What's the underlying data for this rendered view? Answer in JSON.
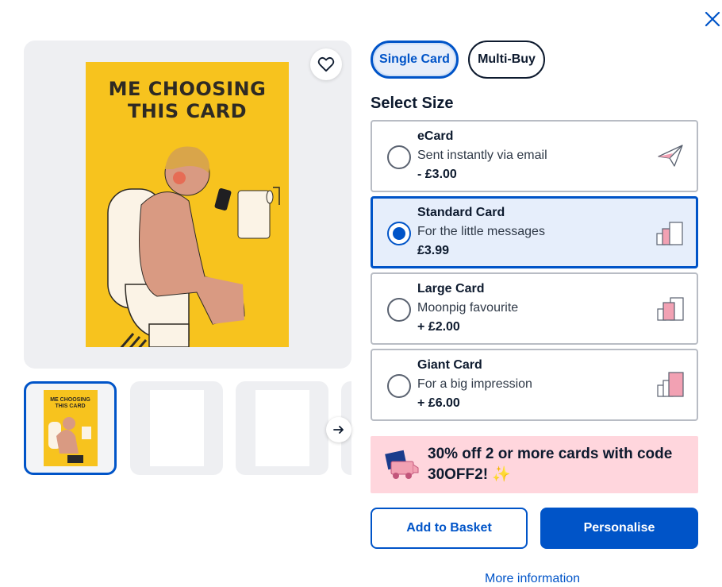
{
  "close": {
    "icon": "close-icon"
  },
  "preview": {
    "card_title_line1": "ME CHOOSING",
    "card_title_line2": "THIS CARD",
    "card_background": "#f7c31e",
    "favourite_icon": "heart-outline-icon"
  },
  "thumbnails": {
    "items": [
      {
        "kind": "card-front",
        "title_line1": "ME CHOOSING",
        "title_line2": "THIS CARD"
      },
      {
        "kind": "blank"
      },
      {
        "kind": "blank"
      },
      {
        "kind": "blank"
      }
    ],
    "next_icon": "arrow-right-icon"
  },
  "tabs": {
    "single_label": "Single Card",
    "multi_label": "Multi-Buy",
    "selected": "Single Card"
  },
  "size": {
    "heading": "Select Size",
    "options": [
      {
        "name": "eCard",
        "desc": "Sent instantly via email",
        "price": "- £3.00",
        "icon": "paper-plane-icon",
        "selected": false
      },
      {
        "name": "Standard Card",
        "desc": "For the little messages",
        "price": "£3.99",
        "icon": "card-size-standard-icon",
        "selected": true
      },
      {
        "name": "Large Card",
        "desc": "Moonpig favourite",
        "price": "+ £2.00",
        "icon": "card-size-large-icon",
        "selected": false
      },
      {
        "name": "Giant Card",
        "desc": "For a big impression",
        "price": "+ £6.00",
        "icon": "card-size-giant-icon",
        "selected": false
      }
    ]
  },
  "promo": {
    "text": "30% off 2 or more cards with code 30OFF2! ✨",
    "icon": "delivery-truck-icon",
    "background": "#ffd6dd"
  },
  "actions": {
    "add_to_basket": "Add to Basket",
    "personalise": "Personalise",
    "more_information": "More information"
  },
  "colors": {
    "brand_blue": "#0054c8",
    "text_dark": "#0d1a2e",
    "pink": "#f2a1b3"
  }
}
